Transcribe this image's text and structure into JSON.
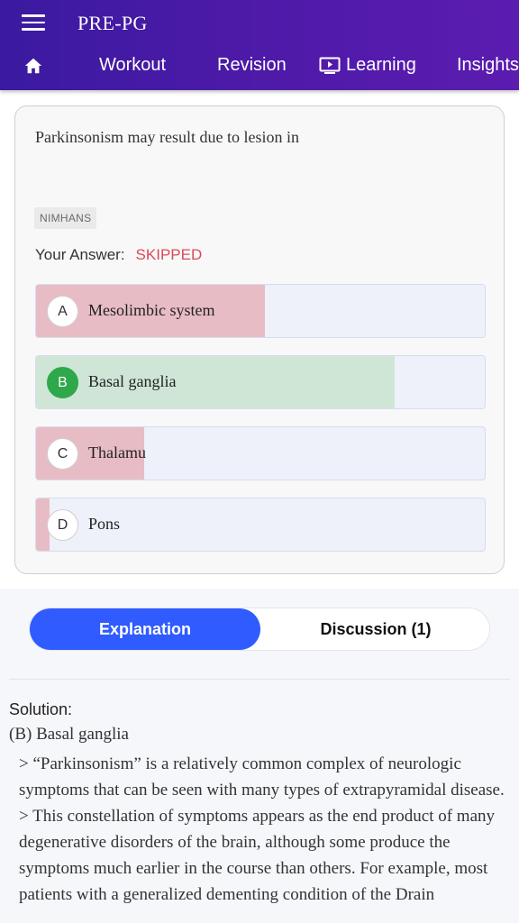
{
  "header": {
    "app_title": "PRE-PG",
    "nav": {
      "workout": "Workout",
      "revision": "Revision",
      "learning": "Learning",
      "insights": "Insights"
    }
  },
  "question": {
    "text": "Parkinsonism may result due to lesion in",
    "source_tag": "NIMHANS",
    "your_answer_label": "Your Answer:",
    "your_answer_value": "SKIPPED",
    "options": [
      {
        "letter": "A",
        "text": "Mesolimbic system",
        "percent": 51,
        "status": "wrong"
      },
      {
        "letter": "B",
        "text": "Basal ganglia",
        "percent": 80,
        "status": "correct"
      },
      {
        "letter": "C",
        "text": "Thalamu",
        "percent": 24,
        "status": "wrong"
      },
      {
        "letter": "D",
        "text": "Pons",
        "percent": 3,
        "status": "wrong"
      }
    ]
  },
  "tabs": {
    "explanation": "Explanation",
    "discussion": "Discussion (1)",
    "active": "explanation"
  },
  "solution": {
    "title": "Solution:",
    "answer": "(B) Basal ganglia",
    "paragraphs": [
      "> “Parkinsonism” is a relatively common complex of neurologic symptoms that can be seen with many types of extrapyramidal disease.",
      "> This constellation of symptoms appears as the end product of many degenerative disorders of the brain, although some produce the symptoms much earlier in the course than others. For example, most patients with a generalized dementing condition of the Drain"
    ]
  },
  "colors": {
    "header": "#4e1aa8",
    "active_tab": "#2f5bff",
    "correct": "#2ea84a",
    "skipped": "#d94a5a",
    "wrong_fill": "#e8bcc5",
    "correct_fill": "#cfe6d6"
  }
}
